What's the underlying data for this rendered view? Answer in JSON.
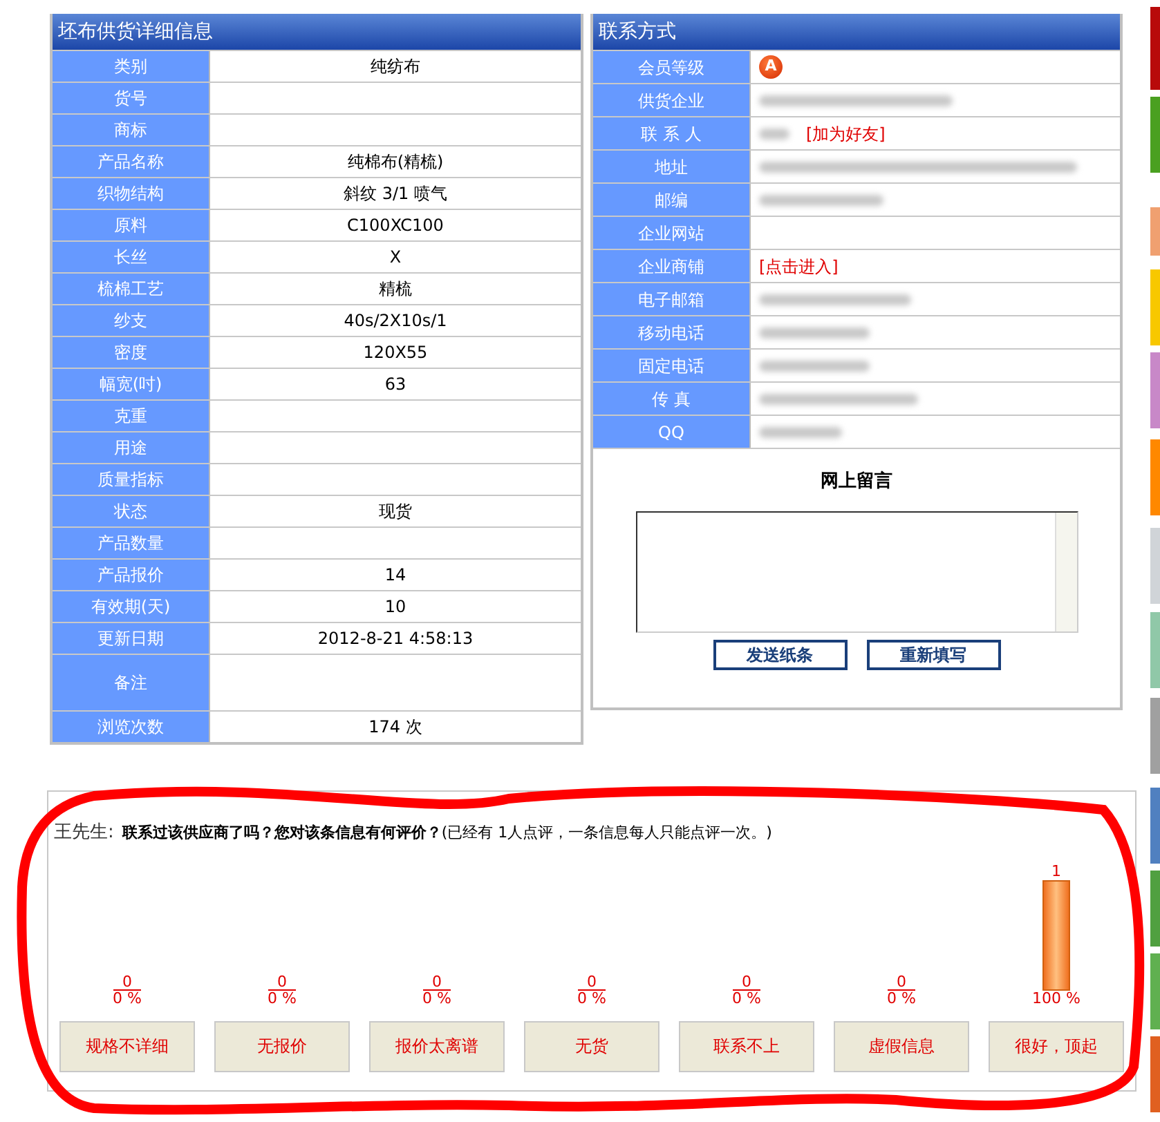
{
  "supply_panel": {
    "title": "坯布供货详细信息",
    "rows": [
      {
        "label": "类别",
        "value": "纯纺布",
        "kind": "text"
      },
      {
        "label": "货号",
        "kind": "text"
      },
      {
        "label": "商标",
        "kind": "text"
      },
      {
        "label": "产品名称",
        "value": "纯棉布(精梳)",
        "kind": "text"
      },
      {
        "label": "织物结构",
        "value": "斜纹 3/1 喷气",
        "kind": "text"
      },
      {
        "label": "原料",
        "value": "C100XC100",
        "kind": "text"
      },
      {
        "label": "长丝",
        "value": "X",
        "kind": "text"
      },
      {
        "label": "梳棉工艺",
        "value": "精梳",
        "kind": "text"
      },
      {
        "label": "纱支",
        "value": "40s/2X10s/1",
        "kind": "text"
      },
      {
        "label": "密度",
        "value": "120X55",
        "kind": "text"
      },
      {
        "label": "幅宽(吋)",
        "value": "63",
        "kind": "text"
      },
      {
        "label": "克重",
        "kind": "text"
      },
      {
        "label": "用途",
        "kind": "text"
      },
      {
        "label": "质量指标",
        "kind": "text"
      },
      {
        "label": "状态",
        "value": "现货",
        "kind": "text"
      },
      {
        "label": "产品数量",
        "kind": "text"
      },
      {
        "label": "产品报价",
        "value": "14",
        "kind": "text"
      },
      {
        "label": "有效期(天)",
        "value": "10",
        "kind": "text"
      },
      {
        "label": "更新日期",
        "value": "2012-8-21 4:58:13",
        "kind": "text"
      },
      {
        "label": "备注",
        "kind": "memo"
      },
      {
        "label": "浏览次数",
        "value": "174 次",
        "kind": "text"
      }
    ]
  },
  "contact_panel": {
    "title": "联系方式",
    "rows": [
      {
        "label": "会员等级",
        "kind": "badge",
        "badge": "A"
      },
      {
        "label": "供货企业",
        "kind": "redacted"
      },
      {
        "label": "联 系 人",
        "kind": "redacted_link",
        "link": "[加为好友]"
      },
      {
        "label": "地址",
        "kind": "redacted"
      },
      {
        "label": "邮编",
        "kind": "redacted"
      },
      {
        "label": "企业网站",
        "kind": "empty"
      },
      {
        "label": "企业商铺",
        "kind": "link",
        "link": "[点击进入]"
      },
      {
        "label": "电子邮箱",
        "kind": "redacted"
      },
      {
        "label": "移动电话",
        "kind": "redacted"
      },
      {
        "label": "固定电话",
        "kind": "redacted"
      },
      {
        "label": "传 真",
        "kind": "redacted"
      },
      {
        "label": "QQ",
        "kind": "redacted"
      }
    ],
    "message": {
      "title": "网上留言",
      "buttons": [
        "发送纸条",
        "重新填写"
      ]
    }
  },
  "rating": {
    "user": "王先生:",
    "question": "联系过该供应商了吗？您对该条信息有何评价？",
    "note": "(已经有 1人点评，一条信息每人只能点评一次。)",
    "options": [
      {
        "label": "规格不详细",
        "count": "0",
        "percent": "0 %",
        "level": 0
      },
      {
        "label": "无报价",
        "count": "0",
        "percent": "0 %",
        "level": 0
      },
      {
        "label": "报价太离谱",
        "count": "0",
        "percent": "0 %",
        "level": 0
      },
      {
        "label": "无货",
        "count": "0",
        "percent": "0 %",
        "level": 0
      },
      {
        "label": "联系不上",
        "count": "0",
        "percent": "0 %",
        "level": 0
      },
      {
        "label": "虚假信息",
        "count": "0",
        "percent": "0 %",
        "level": 0
      },
      {
        "label": "很好，顶起",
        "count": "1",
        "percent": "100 %",
        "level": 1
      }
    ]
  }
}
